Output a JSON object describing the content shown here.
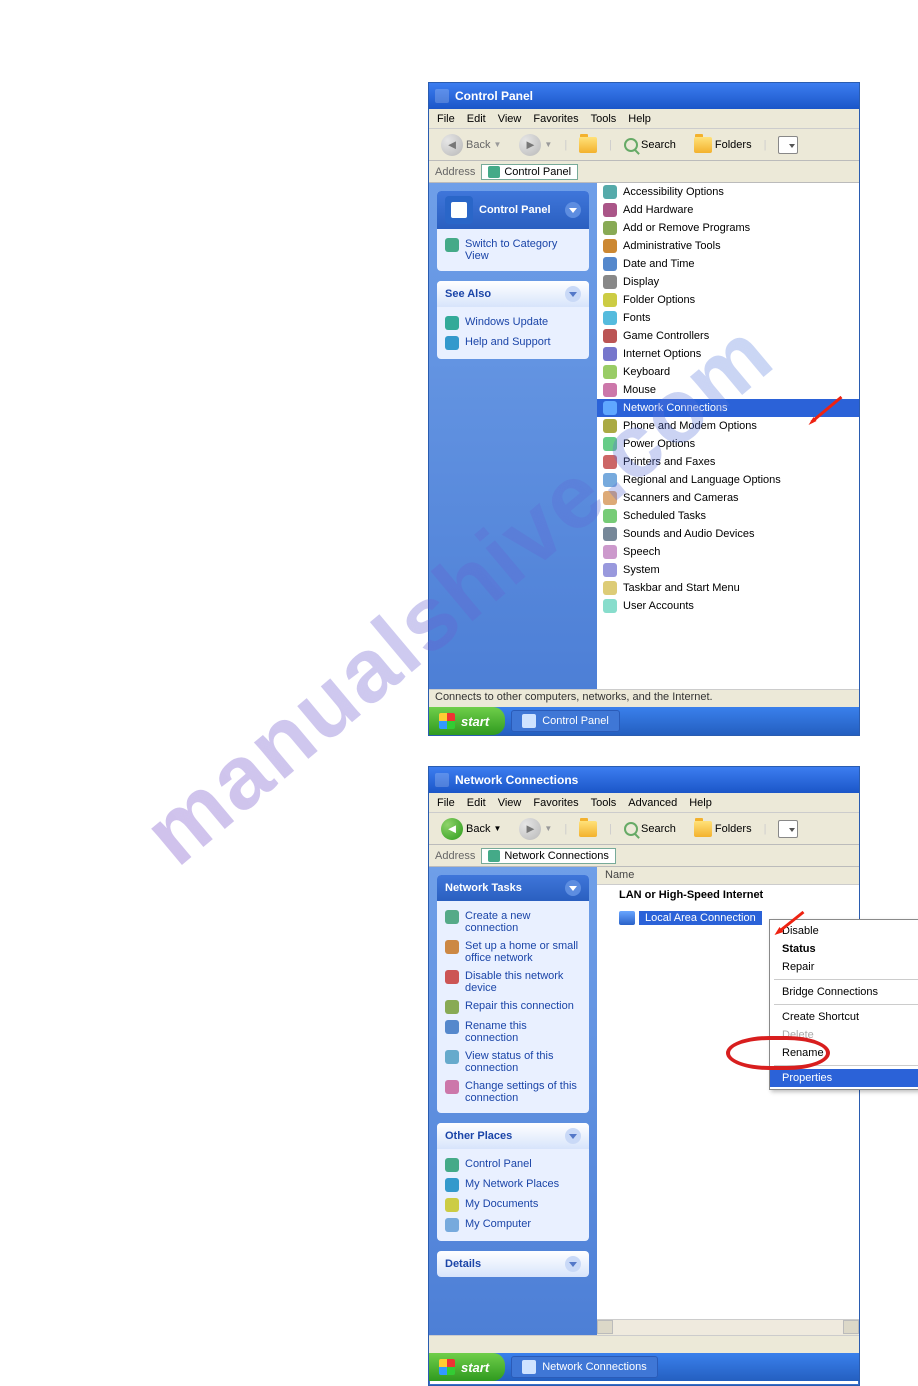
{
  "watermark": "manualshive.com",
  "win1": {
    "title": "Control Panel",
    "menu": [
      "File",
      "Edit",
      "View",
      "Favorites",
      "Tools",
      "Help"
    ],
    "toolbar": {
      "back": "Back",
      "search": "Search",
      "folders": "Folders"
    },
    "address_label": "Address",
    "address_value": "Control Panel",
    "sidebar": {
      "cp_header": "Control Panel",
      "switch_link": "Switch to Category View",
      "seealso_header": "See Also",
      "seealso_links": [
        "Windows Update",
        "Help and Support"
      ]
    },
    "items": [
      "Accessibility Options",
      "Add Hardware",
      "Add or Remove Programs",
      "Administrative Tools",
      "Date and Time",
      "Display",
      "Folder Options",
      "Fonts",
      "Game Controllers",
      "Internet Options",
      "Keyboard",
      "Mouse",
      "Network Connections",
      "Phone and Modem Options",
      "Power Options",
      "Printers and Faxes",
      "Regional and Language Options",
      "Scanners and Cameras",
      "Scheduled Tasks",
      "Sounds and Audio Devices",
      "Speech",
      "System",
      "Taskbar and Start Menu",
      "User Accounts"
    ],
    "selected_index": 12,
    "status": "Connects to other computers, networks, and the Internet.",
    "start": "start",
    "taskbtn": "Control Panel"
  },
  "win2": {
    "title": "Network Connections",
    "menu": [
      "File",
      "Edit",
      "View",
      "Favorites",
      "Tools",
      "Advanced",
      "Help"
    ],
    "toolbar": {
      "back": "Back",
      "search": "Search",
      "folders": "Folders"
    },
    "address_label": "Address",
    "address_value": "Network Connections",
    "sidebar": {
      "tasks_header": "Network Tasks",
      "tasks": [
        "Create a new connection",
        "Set up a home or small office network",
        "Disable this network device",
        "Repair this connection",
        "Rename this connection",
        "View status of this connection",
        "Change settings of this connection"
      ],
      "other_header": "Other Places",
      "other": [
        "Control Panel",
        "My Network Places",
        "My Documents",
        "My Computer"
      ],
      "details_header": "Details"
    },
    "col_name": "Name",
    "category": "LAN or High-Speed Internet",
    "item_label": "Local Area Connection",
    "context": {
      "disable": "Disable",
      "status": "Status",
      "repair": "Repair",
      "bridge": "Bridge Connections",
      "shortcut": "Create Shortcut",
      "delete": "Delete",
      "rename": "Rename",
      "properties": "Properties"
    },
    "start": "start",
    "taskbtn": "Network Connections"
  },
  "icon_colors": [
    "#5aa",
    "#a58",
    "#8a5",
    "#c83",
    "#58c",
    "#888",
    "#cc4",
    "#5bd",
    "#b55",
    "#77c",
    "#9c6",
    "#c7a",
    "#47c",
    "#aa4",
    "#6c8",
    "#c66",
    "#7ad",
    "#da7",
    "#7c7",
    "#789",
    "#c9c",
    "#99d",
    "#dc7",
    "#8dc"
  ]
}
